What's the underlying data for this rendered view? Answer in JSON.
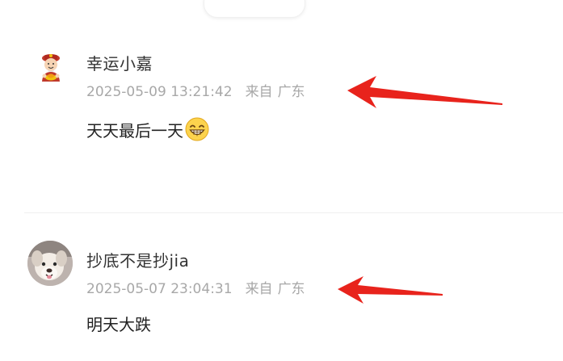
{
  "comments": [
    {
      "username": "幸运小嘉",
      "timestamp": "2025-05-09 13:21:42",
      "location_prefix": "来自",
      "location": "广东",
      "content": "天天最后一天",
      "content_emoji": "grinning-face-emoji",
      "avatar": "fortune-god-avatar"
    },
    {
      "username": "抄底不是抄jia",
      "timestamp": "2025-05-07 23:04:31",
      "location_prefix": "来自",
      "location": "广东",
      "content": "明天大跌",
      "avatar": "dog-photo-avatar"
    }
  ],
  "colors": {
    "username": "#333333",
    "meta": "#a8a8a8",
    "content": "#222222",
    "annotation_arrow": "#e8231c"
  },
  "annotations": [
    "red-arrow",
    "red-arrow"
  ]
}
